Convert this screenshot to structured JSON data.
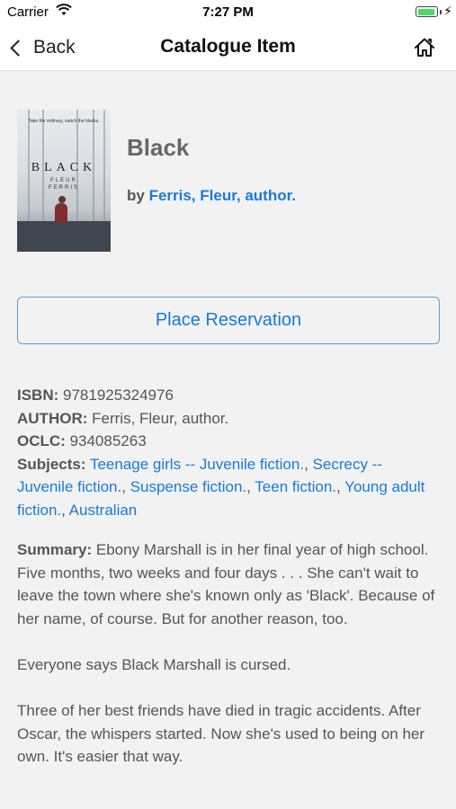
{
  "status_bar": {
    "carrier": "Carrier",
    "time": "7:27 PM"
  },
  "nav": {
    "back_label": "Back",
    "title": "Catalogue Item"
  },
  "cover": {
    "tagline": "Take the ordinary, watch the blacks.",
    "title": "BLACK",
    "author_line1": "FLEUR",
    "author_line2": "FERRIS"
  },
  "item": {
    "title": "Black",
    "by_prefix": "by ",
    "author_link": "Ferris, Fleur, author."
  },
  "reserve_button": "Place Reservation",
  "details": {
    "isbn_label": "ISBN:",
    "isbn_value": "9781925324976",
    "author_label": "AUTHOR:",
    "author_value": "Ferris, Fleur, author.",
    "oclc_label": "OCLC:",
    "oclc_value": "934085263",
    "subjects_label": "Subjects:",
    "subjects": [
      "Teenage girls -- Juvenile fiction.",
      "Secrecy -- Juvenile fiction.",
      "Suspense fiction.",
      "Teen fiction.",
      "Young adult fiction.",
      "Australian"
    ]
  },
  "summary": {
    "label": "Summary:",
    "paragraph1": "Ebony Marshall is in her final year of high school. Five months, two weeks and four days . . . She can't wait to leave the town where she's known only as 'Black'. Because of her name, of course. But for another reason, too.",
    "paragraph2": "Everyone says Black Marshall is cursed.",
    "paragraph3": "Three of her best friends have died in tragic accidents. After Oscar, the whispers started. Now she's used to being on her own. It's easier that way."
  },
  "colors": {
    "link": "#1a7ad9",
    "battery": "#4cd964",
    "background": "#f2f2f2"
  }
}
